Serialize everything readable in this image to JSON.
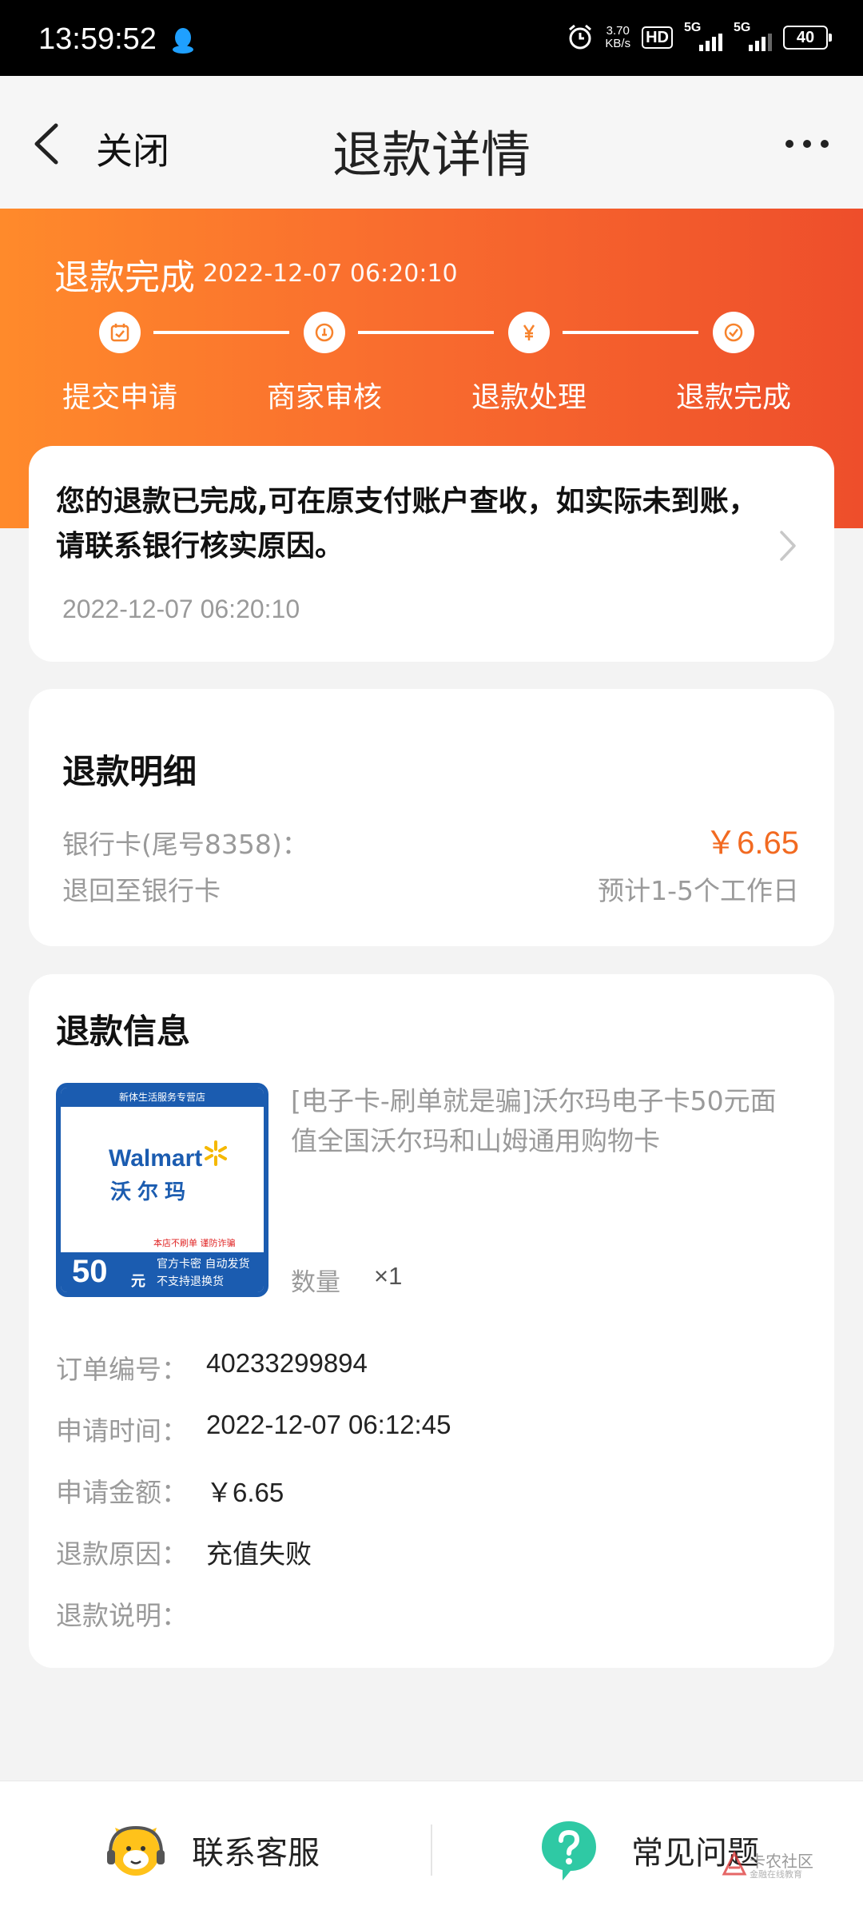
{
  "status_bar": {
    "time": "13:59:52",
    "net_speed_value": "3.70",
    "net_speed_unit": "KB/s",
    "hd_label": "HD",
    "sim1": "5G",
    "sim2": "5G",
    "battery": "40"
  },
  "nav": {
    "close_label": "关闭",
    "title": "退款详情"
  },
  "hero": {
    "status": "退款完成",
    "time": "2022-12-07 06:20:10",
    "steps": [
      {
        "label": "提交申请",
        "icon": "calendar-icon"
      },
      {
        "label": "商家审核",
        "icon": "info-icon"
      },
      {
        "label": "退款处理",
        "icon": "yen-icon"
      },
      {
        "label": "退款完成",
        "icon": "check-icon"
      }
    ]
  },
  "notice": {
    "text": "您的退款已完成,可在原支付账户查收，如实际未到账，请联系银行核实原因。",
    "time": "2022-12-07 06:20:10"
  },
  "refund_detail": {
    "title": "退款明细",
    "method_label": "银行卡(尾号8358)：",
    "amount": "￥6.65",
    "destination": "退回至银行卡",
    "eta": "预计1-5个工作日"
  },
  "refund_info": {
    "title": "退款信息",
    "product_image": {
      "top_text": "新体生活服务专营店",
      "brand": "Walmart",
      "brand_cn": "沃尔玛",
      "warning": "本店不刷单  谨防诈骗",
      "face_value": "50",
      "face_unit": "元",
      "feature1": "官方卡密 自动发货",
      "feature2": "不支持退换货"
    },
    "product_name": "[电子卡-刷单就是骗]沃尔玛电子卡50元面值全国沃尔玛和山姆通用购物卡",
    "qty_label": "数量",
    "qty_value": "×1",
    "rows": [
      {
        "label": "订单编号：",
        "value": "40233299894"
      },
      {
        "label": "申请时间：",
        "value": "2022-12-07 06:12:45"
      },
      {
        "label": "申请金额：",
        "value": "￥6.65"
      },
      {
        "label": "退款原因：",
        "value": "充值失败"
      },
      {
        "label": "退款说明：",
        "value": ""
      }
    ]
  },
  "bottom_bar": {
    "contact_label": "联系客服",
    "faq_label": "常见问题",
    "watermark_main": "卡农社区",
    "watermark_sub": "金融在线教育"
  },
  "colors": {
    "accent": "#f26a21",
    "hero_start": "#ff8a2b",
    "hero_end": "#ee4e2b",
    "faq_green": "#2fc9a4"
  }
}
